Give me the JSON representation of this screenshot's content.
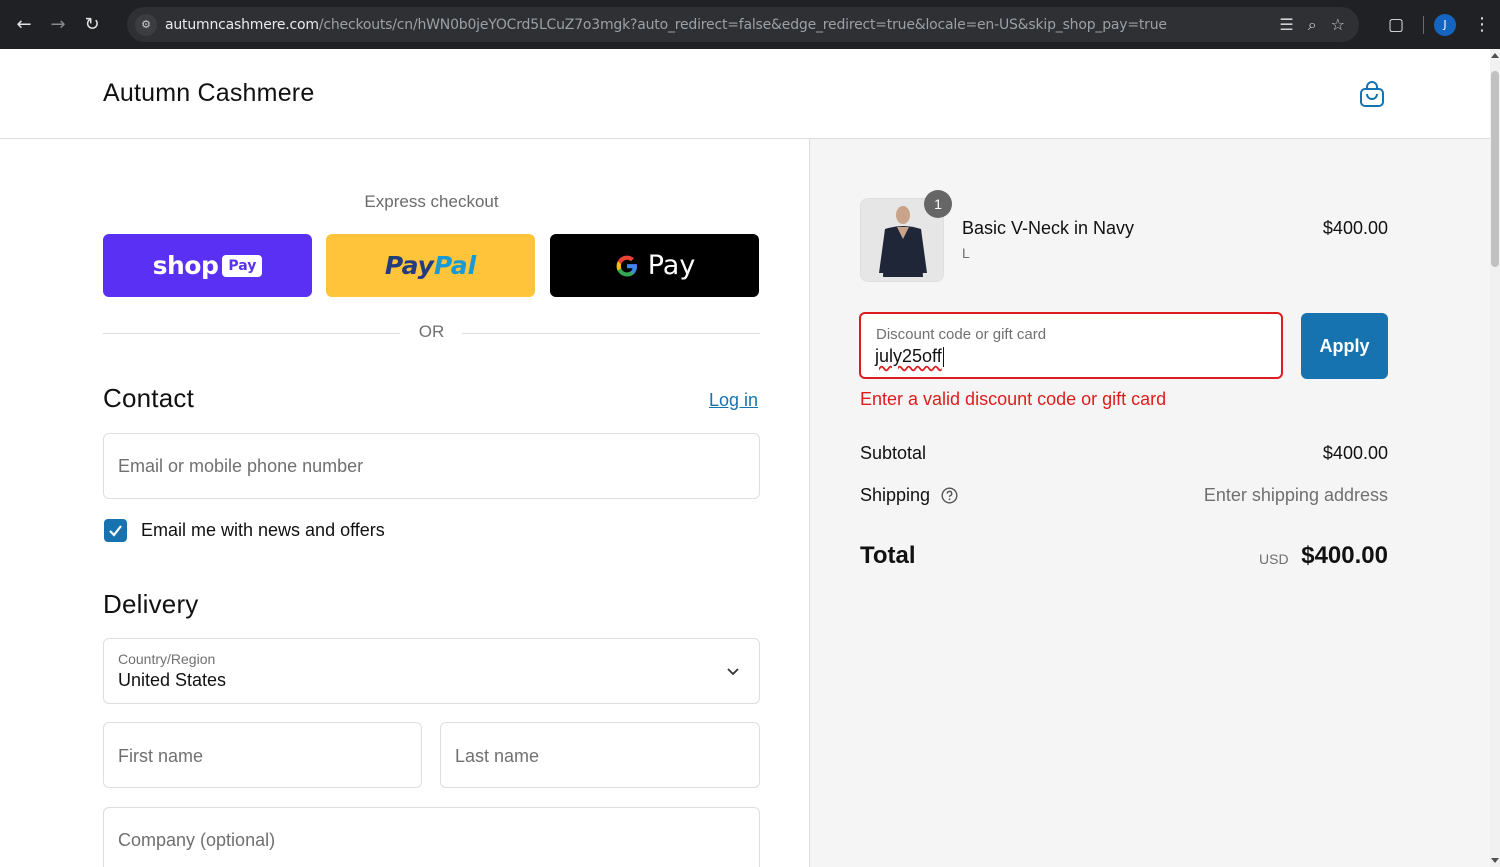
{
  "browser": {
    "url_host": "autumncashmere.com",
    "url_path": "/checkouts/cn/hWN0b0jeYOCrd5LCuZ7o3mgk?auto_redirect=false&edge_redirect=true&locale=en-US&skip_shop_pay=true",
    "profile_initial": "J"
  },
  "header": {
    "brand": "Autumn Cashmere"
  },
  "express": {
    "title": "Express checkout",
    "shop_pay_word": "shop",
    "shop_pay_badge": "Pay",
    "paypal_part1": "Pay",
    "paypal_part2": "Pal",
    "gpay_word": "Pay",
    "or_text": "OR"
  },
  "contact": {
    "title": "Contact",
    "login_link": "Log in",
    "email_placeholder": "Email or mobile phone number",
    "news_checkbox_label": "Email me with news and offers",
    "news_checked": true
  },
  "delivery": {
    "title": "Delivery",
    "country_label": "Country/Region",
    "country_value": "United States",
    "first_name_placeholder": "First name",
    "last_name_placeholder": "Last name",
    "company_placeholder": "Company (optional)"
  },
  "summary": {
    "item": {
      "name": "Basic V-Neck in Navy",
      "variant": "L",
      "price": "$400.00",
      "quantity": "1"
    },
    "discount": {
      "label": "Discount code or gift card",
      "value": "july25off",
      "apply_label": "Apply",
      "error": "Enter a valid discount code or gift card"
    },
    "subtotal_label": "Subtotal",
    "subtotal_value": "$400.00",
    "shipping_label": "Shipping",
    "shipping_value": "Enter shipping address",
    "total_label": "Total",
    "total_currency": "USD",
    "total_value": "$400.00"
  },
  "colors": {
    "accent": "#1773b0",
    "error": "#dd1d1d",
    "shop_pay": "#5a31f4",
    "paypal": "#ffc439"
  }
}
